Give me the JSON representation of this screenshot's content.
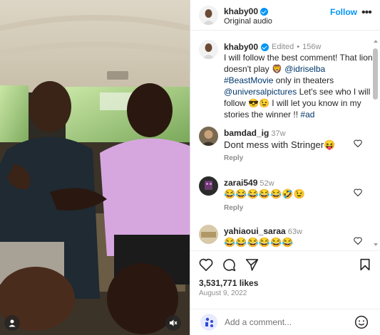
{
  "post": {
    "username": "khaby00",
    "audio": "Original audio",
    "follow_label": "Follow",
    "more_label": "•••"
  },
  "caption": {
    "username": "khaby00",
    "edited": "Edited",
    "dot": "•",
    "time": "156w",
    "text_1": "I will follow the best comment! That lion doesn't play 🦁",
    "mention_1": "@idriselba",
    "hashtag_1": "#BeastMovie",
    "text_2": "only in theaters",
    "mention_2": "@universalpictures",
    "text_3": "Let's see who I will follow 😎😉 I will let you know in my stories the winner !!",
    "hashtag_2": "#ad"
  },
  "comments": [
    {
      "username": "bamdad_ig",
      "time": "37w",
      "text": "Dont mess with Stringer😝",
      "reply": "Reply"
    },
    {
      "username": "zarai549",
      "time": "52w",
      "text": "😂😂😂😂😂🤣😉",
      "reply": "Reply"
    },
    {
      "username": "yahiaoui_saraa",
      "time": "63w",
      "text": "😂😂😂😂😂😂"
    }
  ],
  "stats": {
    "likes": "3,531,771 likes",
    "date": "August 9, 2022"
  },
  "add_comment": {
    "placeholder": "Add a comment..."
  },
  "icons": {
    "like": "heart-icon",
    "comment": "comment-icon",
    "share": "send-icon",
    "save": "bookmark-icon",
    "user_tag": "user-icon",
    "mute": "speaker-muted-icon",
    "emoji": "emoji-icon"
  },
  "colors": {
    "accent": "#0095f6",
    "link": "#00376b",
    "muted": "#8e8e8e"
  }
}
